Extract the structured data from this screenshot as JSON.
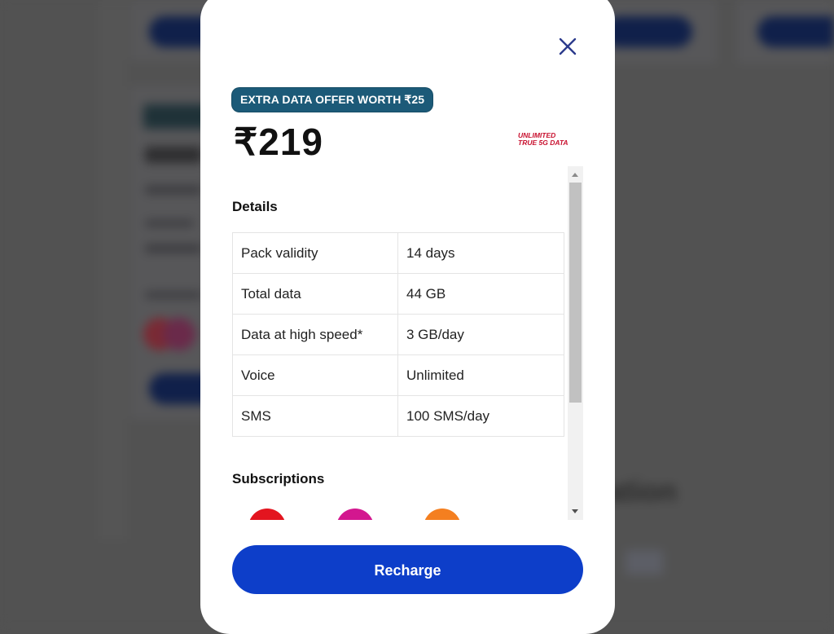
{
  "modal": {
    "close_icon": "close-icon",
    "offer_badge": "EXTRA DATA OFFER WORTH ₹25",
    "price": "₹219",
    "promo_line1": "UNLIMITED",
    "promo_line2": "TRUE 5G DATA",
    "details": {
      "title": "Details",
      "rows": [
        {
          "label": "Pack validity",
          "value": "14 days"
        },
        {
          "label": "Total data",
          "value": "44 GB"
        },
        {
          "label": "Data at high speed*",
          "value": "3 GB/day"
        },
        {
          "label": "Voice",
          "value": "Unlimited"
        },
        {
          "label": "SMS",
          "value": "100 SMS/day"
        }
      ]
    },
    "subscriptions": {
      "title": "Subscriptions",
      "items": [
        {
          "icon": "subscription-red-icon",
          "color": "#e3151f"
        },
        {
          "icon": "subscription-magenta-icon",
          "color": "#d3178f"
        },
        {
          "icon": "subscription-orange-icon",
          "color": "#f47f20"
        }
      ]
    },
    "recharge_label": "Recharge"
  },
  "colors": {
    "badge": "#1c5a78",
    "primary": "#0d3ec9",
    "promo": "#c8102e",
    "overlay": "#525252"
  }
}
